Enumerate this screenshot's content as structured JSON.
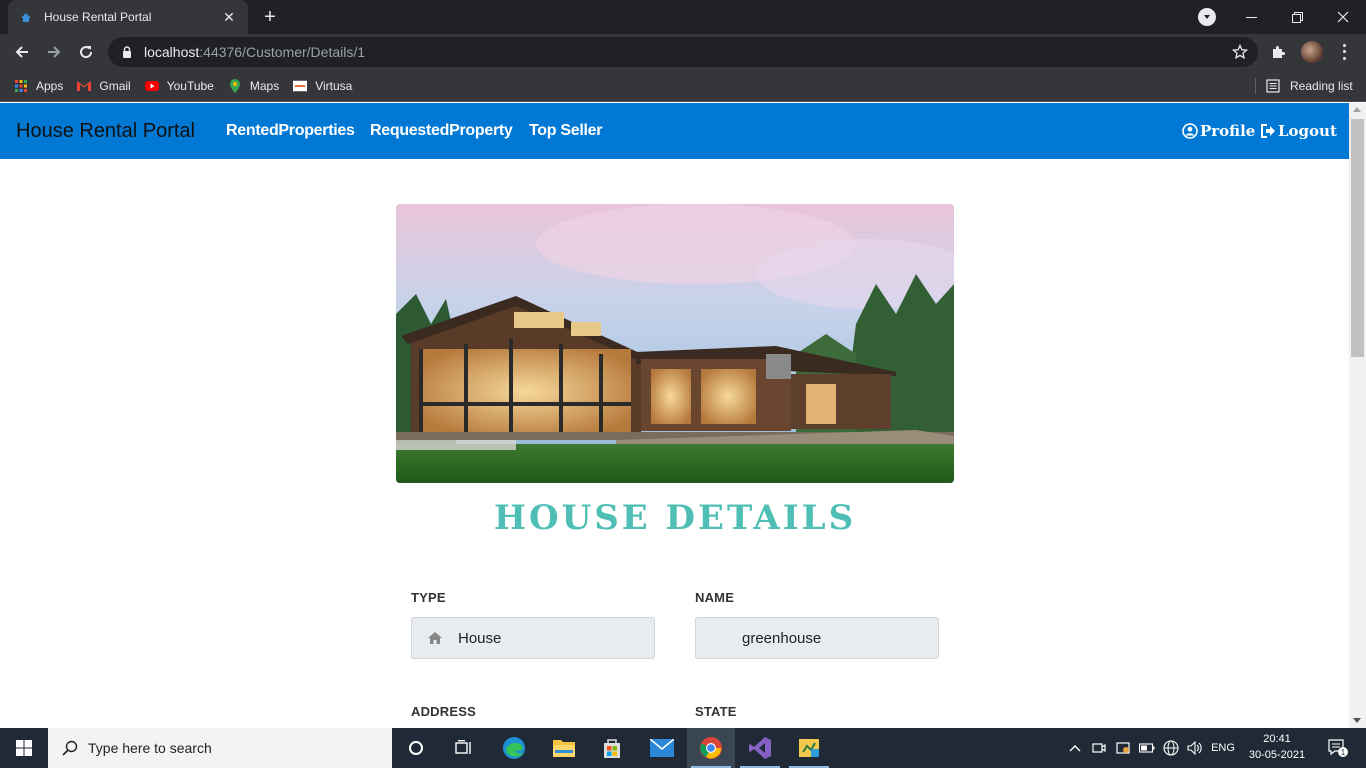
{
  "browser": {
    "tab_title": "House Rental Portal",
    "tab_close": "✕",
    "new_tab": "+",
    "url_host": "localhost",
    "url_path": ":44376/Customer/Details/1",
    "bookmarks": [
      "Apps",
      "Gmail",
      "YouTube",
      "Maps",
      "Virtusa"
    ],
    "reading_list": "Reading list"
  },
  "navbar": {
    "brand": "House Rental Portal",
    "links": [
      "RentedProperties",
      "RequestedProperty",
      "Top Seller"
    ],
    "profile": "Profile",
    "logout": "Logout"
  },
  "page": {
    "heading": "HOUSE DETAILS",
    "heading_color": "#4fbfb5",
    "fields": [
      {
        "label": "TYPE",
        "value": "House",
        "icon": "home-icon"
      },
      {
        "label": "NAME",
        "value": "greenhouse"
      },
      {
        "label": "ADDRESS"
      },
      {
        "label": "STATE"
      }
    ]
  },
  "taskbar": {
    "search_placeholder": "Type here to search",
    "language": "ENG",
    "time": "20:41",
    "date": "30-05-2021",
    "notification_count": "1"
  },
  "colors": {
    "navbar": "#0078d4",
    "chrome_dark": "#202124",
    "chrome_toolbar": "#35363a"
  }
}
